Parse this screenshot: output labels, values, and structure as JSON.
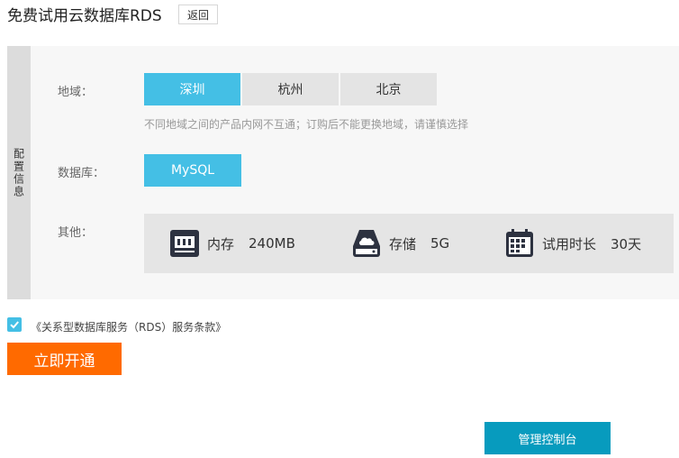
{
  "header": {
    "title": "免费试用云数据库RDS",
    "back_label": "返回"
  },
  "config": {
    "side_label": "配置信息",
    "region": {
      "label": "地域：",
      "options": [
        "深圳",
        "杭州",
        "北京"
      ],
      "selected": "深圳",
      "hint": "不同地域之间的产品内网不互通；订购后不能更换地域，请谨慎选择"
    },
    "database": {
      "label": "数据库：",
      "option": "MySQL"
    },
    "others": {
      "label": "其他：",
      "items": [
        {
          "name": "内存",
          "value": "240MB",
          "icon": "memory-icon"
        },
        {
          "name": "存储",
          "value": "5G",
          "icon": "storage-icon"
        },
        {
          "name": "试用时长",
          "value": "30天",
          "icon": "calendar-icon"
        }
      ]
    }
  },
  "agreement": {
    "checked": true,
    "text": "《关系型数据库服务（RDS）服务条款》"
  },
  "actions": {
    "open_label": "立即开通",
    "console_label": "管理控制台"
  },
  "colors": {
    "accent": "#44bfe5",
    "orange": "#ff6a00",
    "console": "#079bbe",
    "dark_icon": "#2d3240"
  }
}
